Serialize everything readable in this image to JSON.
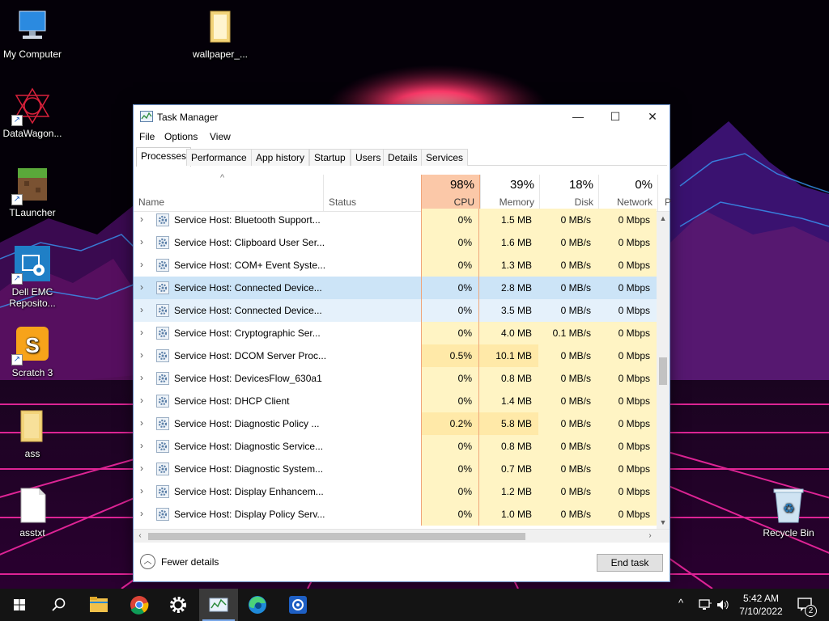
{
  "desktop": {
    "icons": [
      {
        "label": "My Computer",
        "icon": "computer-icon"
      },
      {
        "label": "wallpaper_...",
        "icon": "folder-icon"
      },
      {
        "label": "DataWagon...",
        "icon": "datawagon-icon"
      },
      {
        "label": "TLauncher",
        "icon": "minecraft-block-icon"
      },
      {
        "label": "Dell EMC Reposito...",
        "icon": "dell-repository-icon"
      },
      {
        "label": "Scratch 3",
        "icon": "scratch-icon"
      },
      {
        "label": "ass",
        "icon": "folder-icon"
      },
      {
        "label": "asstxt",
        "icon": "text-file-icon"
      },
      {
        "label": "Recycle Bin",
        "icon": "recycle-bin-icon"
      }
    ]
  },
  "window": {
    "title": "Task Manager",
    "controls": {
      "minimize": "—",
      "maximize": "☐",
      "close": "✕"
    }
  },
  "menu": [
    "File",
    "Options",
    "View"
  ],
  "tabs": [
    "Processes",
    "Performance",
    "App history",
    "Startup",
    "Users",
    "Details",
    "Services"
  ],
  "active_tab": "Processes",
  "columns": {
    "name": "Name",
    "status": "Status",
    "cpu": {
      "pct": "98%",
      "label": "CPU"
    },
    "memory": {
      "pct": "39%",
      "label": "Memory"
    },
    "disk": {
      "pct": "18%",
      "label": "Disk"
    },
    "network": {
      "pct": "0%",
      "label": "Network"
    },
    "cutoff": "P",
    "sort_arrow": "^"
  },
  "processes": [
    {
      "name": "Service Host: Bluetooth Support...",
      "cpu": "0%",
      "memory": "1.5 MB",
      "disk": "0 MB/s",
      "network": "0 Mbps"
    },
    {
      "name": "Service Host: Clipboard User Ser...",
      "cpu": "0%",
      "memory": "1.6 MB",
      "disk": "0 MB/s",
      "network": "0 Mbps"
    },
    {
      "name": "Service Host: COM+ Event Syste...",
      "cpu": "0%",
      "memory": "1.3 MB",
      "disk": "0 MB/s",
      "network": "0 Mbps"
    },
    {
      "name": "Service Host: Connected Device...",
      "cpu": "0%",
      "memory": "2.8 MB",
      "disk": "0 MB/s",
      "network": "0 Mbps"
    },
    {
      "name": "Service Host: Connected Device...",
      "cpu": "0%",
      "memory": "3.5 MB",
      "disk": "0 MB/s",
      "network": "0 Mbps"
    },
    {
      "name": "Service Host: Cryptographic Ser...",
      "cpu": "0%",
      "memory": "4.0 MB",
      "disk": "0.1 MB/s",
      "network": "0 Mbps"
    },
    {
      "name": "Service Host: DCOM Server Proc...",
      "cpu": "0.5%",
      "memory": "10.1 MB",
      "disk": "0 MB/s",
      "network": "0 Mbps"
    },
    {
      "name": "Service Host: DevicesFlow_630a1",
      "cpu": "0%",
      "memory": "0.8 MB",
      "disk": "0 MB/s",
      "network": "0 Mbps"
    },
    {
      "name": "Service Host: DHCP Client",
      "cpu": "0%",
      "memory": "1.4 MB",
      "disk": "0 MB/s",
      "network": "0 Mbps"
    },
    {
      "name": "Service Host: Diagnostic Policy ...",
      "cpu": "0.2%",
      "memory": "5.8 MB",
      "disk": "0 MB/s",
      "network": "0 Mbps"
    },
    {
      "name": "Service Host: Diagnostic Service...",
      "cpu": "0%",
      "memory": "0.8 MB",
      "disk": "0 MB/s",
      "network": "0 Mbps"
    },
    {
      "name": "Service Host: Diagnostic System...",
      "cpu": "0%",
      "memory": "0.7 MB",
      "disk": "0 MB/s",
      "network": "0 Mbps"
    },
    {
      "name": "Service Host: Display Enhancem...",
      "cpu": "0%",
      "memory": "1.2 MB",
      "disk": "0 MB/s",
      "network": "0 Mbps"
    },
    {
      "name": "Service Host: Display Policy Serv...",
      "cpu": "0%",
      "memory": "1.0 MB",
      "disk": "0 MB/s",
      "network": "0 Mbps"
    }
  ],
  "footer": {
    "fewer_details": "Fewer details",
    "end_task": "End task"
  },
  "taskbar": {
    "apps": [
      "start-icon",
      "search-icon",
      "file-explorer-icon",
      "chrome-icon",
      "settings-icon",
      "task-manager-icon",
      "edge-icon",
      "app-icon"
    ],
    "tray": {
      "chevron": "^",
      "notification_count": "2"
    },
    "clock": {
      "time": "5:42 AM",
      "date": "7/10/2022"
    }
  }
}
